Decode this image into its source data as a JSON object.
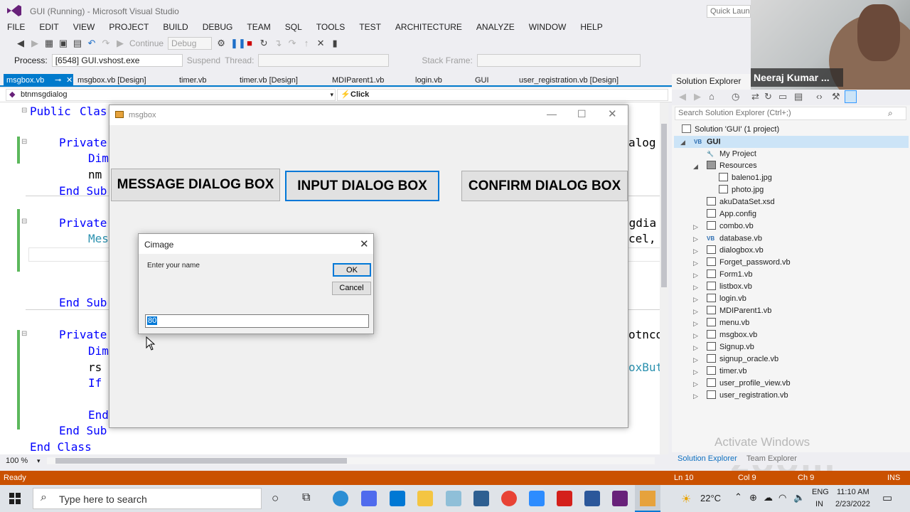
{
  "app": {
    "window_title": "GUI (Running) - Microsoft Visual Studio",
    "quick_launch": "Quick Launch"
  },
  "menu": [
    "FILE",
    "EDIT",
    "VIEW",
    "PROJECT",
    "BUILD",
    "DEBUG",
    "TEAM",
    "SQL",
    "TOOLS",
    "TEST",
    "ARCHITECTURE",
    "ANALYZE",
    "WINDOW",
    "HELP"
  ],
  "toolbar": {
    "continue": "Continue",
    "config": "Debug",
    "process_label": "Process:",
    "process_value": "[6548] GUI.vshost.exe",
    "suspend": "Suspend",
    "thread": "Thread:",
    "stack_frame": "Stack Frame:"
  },
  "doc_tabs": [
    "msgbox.vb",
    "msgbox.vb [Design]",
    "timer.vb",
    "timer.vb [Design]",
    "MDIParent1.vb",
    "login.vb",
    "GUI",
    "user_registration.vb [Design]"
  ],
  "navbar": {
    "left": "btnmsgdialog",
    "right": "Click"
  },
  "code": {
    "public_kw": "Public ",
    "class_kw": "Clas",
    "private1": "Private",
    "dim1": "Dim",
    "nm": "nm",
    "end_sub1": "End Sub",
    "private2": "Private",
    "mes": "Mes",
    "end_sub2": "End Sub",
    "private3": "Private",
    "dim3": "Dim",
    "rs": "rs",
    "if_kw": "If",
    "end_inner": "End",
    "end_sub3": "End Sub",
    "end_class": "End Class",
    "right1": "alog",
    "right2": "sgdia",
    "right3": "cel,",
    "right4": "otnco",
    "right5": "oxBut"
  },
  "zoom": "100 %",
  "form": {
    "title": "msgbox",
    "btn_message": "MESSAGE DIALOG BOX",
    "btn_input": "INPUT DIALOG BOX",
    "btn_confirm": "CONFIRM DIALOG BOX"
  },
  "inputbox": {
    "title": "Cimage",
    "prompt": "Enter your name",
    "ok": "OK",
    "cancel": "Cancel",
    "value": "80"
  },
  "solution_explorer": {
    "title": "Solution Explorer",
    "search_placeholder": "Search Solution Explorer (Ctrl+;)",
    "solution": "Solution 'GUI' (1 project)",
    "project": "GUI",
    "my_project": "My Project",
    "resources": "Resources",
    "res_files": [
      "baleno1.jpg",
      "photo.jpg"
    ],
    "items": [
      "akuDataSet.xsd",
      "App.config",
      "combo.vb",
      "database.vb",
      "dialogbox.vb",
      "Forget_password.vb",
      "Form1.vb",
      "listbox.vb",
      "login.vb",
      "MDIParent1.vb",
      "menu.vb",
      "msgbox.vb",
      "Signup.vb",
      "signup_oracle.vb",
      "timer.vb",
      "user_profile_view.vb",
      "user_registration.vb"
    ],
    "tab1": "Solution Explorer",
    "tab2": "Team Explorer"
  },
  "webcam": {
    "name": "Neeraj Kumar ..."
  },
  "watermark": {
    "activate": "Activate Windows",
    "zoom": "zoom"
  },
  "status": {
    "ready": "Ready",
    "ln": "Ln 10",
    "col": "Col 9",
    "ch": "Ch 9",
    "ins": "INS"
  },
  "taskbar": {
    "search": "Type here to search",
    "temp": "22°C",
    "lang1": "ENG",
    "lang2": "IN",
    "time": "11:10 AM",
    "date": "2/23/2022"
  }
}
